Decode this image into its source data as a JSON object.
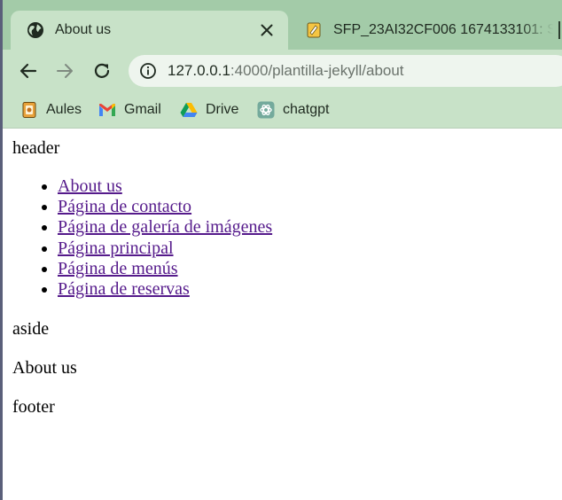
{
  "browser": {
    "tabs": [
      {
        "title": "About us",
        "favicon": "globe-icon",
        "active": true
      },
      {
        "title": "SFP_23AI32CF006 1674133101: S",
        "favicon": "document-icon",
        "active": false
      }
    ],
    "address": {
      "host": "127.0.0.1",
      "path": ":4000/plantilla-jekyll/about"
    },
    "bookmarks": [
      {
        "label": "Aules",
        "icon": "aules-icon"
      },
      {
        "label": "Gmail",
        "icon": "gmail-icon"
      },
      {
        "label": "Drive",
        "icon": "drive-icon"
      },
      {
        "label": "chatgpt",
        "icon": "chatgpt-icon"
      }
    ],
    "theme": {
      "frame": "#a3cba8",
      "toolbar": "#c8e2c8",
      "omnibox": "#eef5ee"
    }
  },
  "page": {
    "header": "header",
    "nav": [
      "About us",
      "Página de contacto",
      "Página de galería de imágenes",
      "Página principal",
      "Página de menús",
      "Página de reservas"
    ],
    "aside": "aside",
    "main": "About us",
    "footer": "footer",
    "link_color": "#551a8b"
  }
}
